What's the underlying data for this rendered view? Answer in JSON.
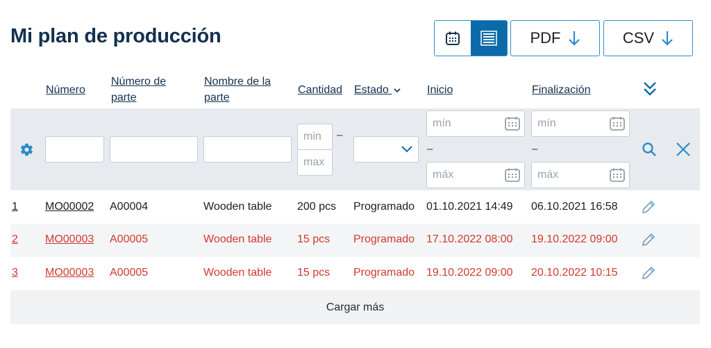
{
  "page": {
    "title": "Mi plan de producción"
  },
  "toolbar": {
    "calendar_view_icon": "calendar-icon",
    "list_view_icon": "list-icon",
    "pdf_label": "PDF",
    "csv_label": "CSV",
    "accent": "#2d8bc9",
    "active_bg": "#0d6aa8"
  },
  "columns": {
    "numero": "Número",
    "numero_parte": "Número de parte",
    "nombre_parte": "Nombre de la parte",
    "cantidad": "Cantidad",
    "estado": "Estado",
    "inicio": "Inicio",
    "finalizacion": "Finalización"
  },
  "filters": {
    "cantidad_min_placeholder": "min",
    "cantidad_max_placeholder": "max",
    "date_min_placeholder": "mín",
    "date_max_placeholder": "máx",
    "dash": "–"
  },
  "rows": [
    {
      "index": "1",
      "numero": "MO00002",
      "parte": "A00004",
      "nombre": "Wooden table",
      "cantidad": "200 pcs",
      "estado": "Programado",
      "inicio": "01.10.2021 14:49",
      "fin": "06.10.2021 16:58"
    },
    {
      "index": "2",
      "numero": "MO00003",
      "parte": "A00005",
      "nombre": "Wooden table",
      "cantidad": "15 pcs",
      "estado": "Programado",
      "inicio": "17.10.2022 08:00",
      "fin": "19.10.2022 09:00"
    },
    {
      "index": "3",
      "numero": "MO00003",
      "parte": "A00005",
      "nombre": "Wooden table",
      "cantidad": "15 pcs",
      "estado": "Programado",
      "inicio": "19.10.2022 09:00",
      "fin": "20.10.2022 10:15"
    }
  ],
  "status_colors": {
    "late": "#d03a2b",
    "normal": "#1d1d1f"
  },
  "load_more": "Cargar más"
}
